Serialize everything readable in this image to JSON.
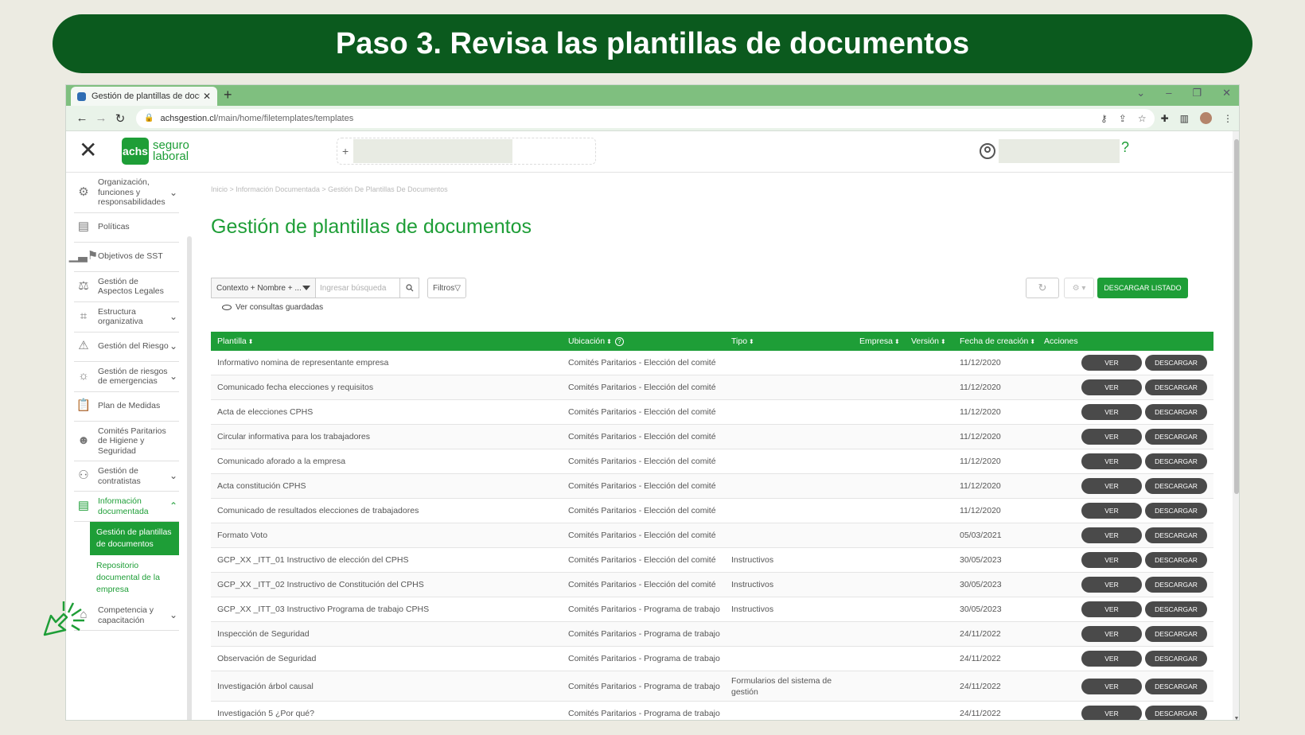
{
  "banner": {
    "title": "Paso 3. Revisa las plantillas de documentos"
  },
  "browser": {
    "tab_title": "Gestión de plantillas de docume",
    "url_domain": "achsgestion.cl",
    "url_path": "/main/home/filetemplates/templates"
  },
  "app": {
    "logo_mark": "achs",
    "logo_line1": "seguro",
    "logo_line2": "laboral"
  },
  "sidebar": {
    "items": [
      {
        "label": "Organización, funciones y responsabilidades",
        "icon": "network-icon",
        "chevron": "down"
      },
      {
        "label": "Políticas",
        "icon": "document-icon",
        "chevron": ""
      },
      {
        "label": "Objetivos de SST",
        "icon": "chart-flag-icon",
        "chevron": ""
      },
      {
        "label": "Gestión de Aspectos Legales",
        "icon": "scales-icon",
        "chevron": ""
      },
      {
        "label": "Estructura organizativa",
        "icon": "org-chart-icon",
        "chevron": "down"
      },
      {
        "label": "Gestión del Riesgo",
        "icon": "warning-icon",
        "chevron": "down"
      },
      {
        "label": "Gestión de riesgos de emergencias",
        "icon": "siren-icon",
        "chevron": "down"
      },
      {
        "label": "Plan de Medidas",
        "icon": "clipboard-icon",
        "chevron": ""
      },
      {
        "label": "Comités Paritarios de Higiene y Seguridad",
        "icon": "group-icon",
        "chevron": ""
      },
      {
        "label": "Gestión de contratistas",
        "icon": "handshake-icon",
        "chevron": "down"
      },
      {
        "label": "Información documentada",
        "icon": "documents-icon",
        "chevron": "up",
        "active": true
      }
    ],
    "subitems": [
      {
        "label": "Gestión de plantillas de documentos",
        "selected": true
      },
      {
        "label": "Repositorio documental de la empresa",
        "selected": false
      }
    ],
    "last_item": {
      "label": "Competencia y capacitación",
      "icon": "graduation-icon",
      "chevron": "down"
    }
  },
  "main": {
    "breadcrumb": "Inicio > Información Documentada > Gestión De Plantillas De Documentos",
    "title": "Gestión de plantillas de documentos",
    "search": {
      "context_value": "Contexto + Nombre + ...",
      "placeholder": "Ingresar búsqueda",
      "filters_label": "Filtros"
    },
    "saved_queries": "Ver consultas guardadas",
    "download_list": "DESCARGAR LISTADO"
  },
  "table": {
    "columns": [
      "Plantilla",
      "Ubicación",
      "Tipo",
      "Empresa",
      "Versión",
      "Fecha de creación",
      "Acciones"
    ],
    "ver_label": "VER",
    "descargar_label": "DESCARGAR",
    "rows": [
      {
        "plantilla": "Informativo nomina de representante empresa",
        "ubicacion": "Comités Paritarios - Elección del comité",
        "tipo": "",
        "fecha": "11/12/2020"
      },
      {
        "plantilla": "Comunicado fecha elecciones y requisitos",
        "ubicacion": "Comités Paritarios - Elección del comité",
        "tipo": "",
        "fecha": "11/12/2020"
      },
      {
        "plantilla": "Acta de elecciones CPHS",
        "ubicacion": "Comités Paritarios - Elección del comité",
        "tipo": "",
        "fecha": "11/12/2020"
      },
      {
        "plantilla": "Circular informativa para los trabajadores",
        "ubicacion": "Comités Paritarios - Elección del comité",
        "tipo": "",
        "fecha": "11/12/2020"
      },
      {
        "plantilla": "Comunicado aforado a la empresa",
        "ubicacion": "Comités Paritarios - Elección del comité",
        "tipo": "",
        "fecha": "11/12/2020"
      },
      {
        "plantilla": "Acta constitución CPHS",
        "ubicacion": "Comités Paritarios - Elección del comité",
        "tipo": "",
        "fecha": "11/12/2020"
      },
      {
        "plantilla": "Comunicado de resultados elecciones de trabajadores",
        "ubicacion": "Comités Paritarios - Elección del comité",
        "tipo": "",
        "fecha": "11/12/2020"
      },
      {
        "plantilla": "Formato Voto",
        "ubicacion": "Comités Paritarios - Elección del comité",
        "tipo": "",
        "fecha": "05/03/2021"
      },
      {
        "plantilla": "GCP_XX _ITT_01 Instructivo de elección del CPHS",
        "ubicacion": "Comités Paritarios - Elección del comité",
        "tipo": "Instructivos",
        "fecha": "30/05/2023"
      },
      {
        "plantilla": "GCP_XX _ITT_02 Instructivo de Constitución del CPHS",
        "ubicacion": "Comités Paritarios - Elección del comité",
        "tipo": "Instructivos",
        "fecha": "30/05/2023"
      },
      {
        "plantilla": "GCP_XX _ITT_03 Instructivo Programa de trabajo CPHS",
        "ubicacion": "Comités Paritarios - Programa de trabajo",
        "tipo": "Instructivos",
        "fecha": "30/05/2023"
      },
      {
        "plantilla": "Inspección de Seguridad",
        "ubicacion": "Comités Paritarios - Programa de trabajo",
        "tipo": "",
        "fecha": "24/11/2022"
      },
      {
        "plantilla": "Observación de Seguridad",
        "ubicacion": "Comités Paritarios - Programa de trabajo",
        "tipo": "",
        "fecha": "24/11/2022"
      },
      {
        "plantilla": "Investigación árbol causal",
        "ubicacion": "Comités Paritarios - Programa de trabajo",
        "tipo": "Formularios del sistema de gestión",
        "fecha": "24/11/2022"
      },
      {
        "plantilla": "Investigación 5 ¿Por qué?",
        "ubicacion": "Comités Paritarios - Programa de trabajo",
        "tipo": "",
        "fecha": "24/11/2022"
      }
    ]
  }
}
